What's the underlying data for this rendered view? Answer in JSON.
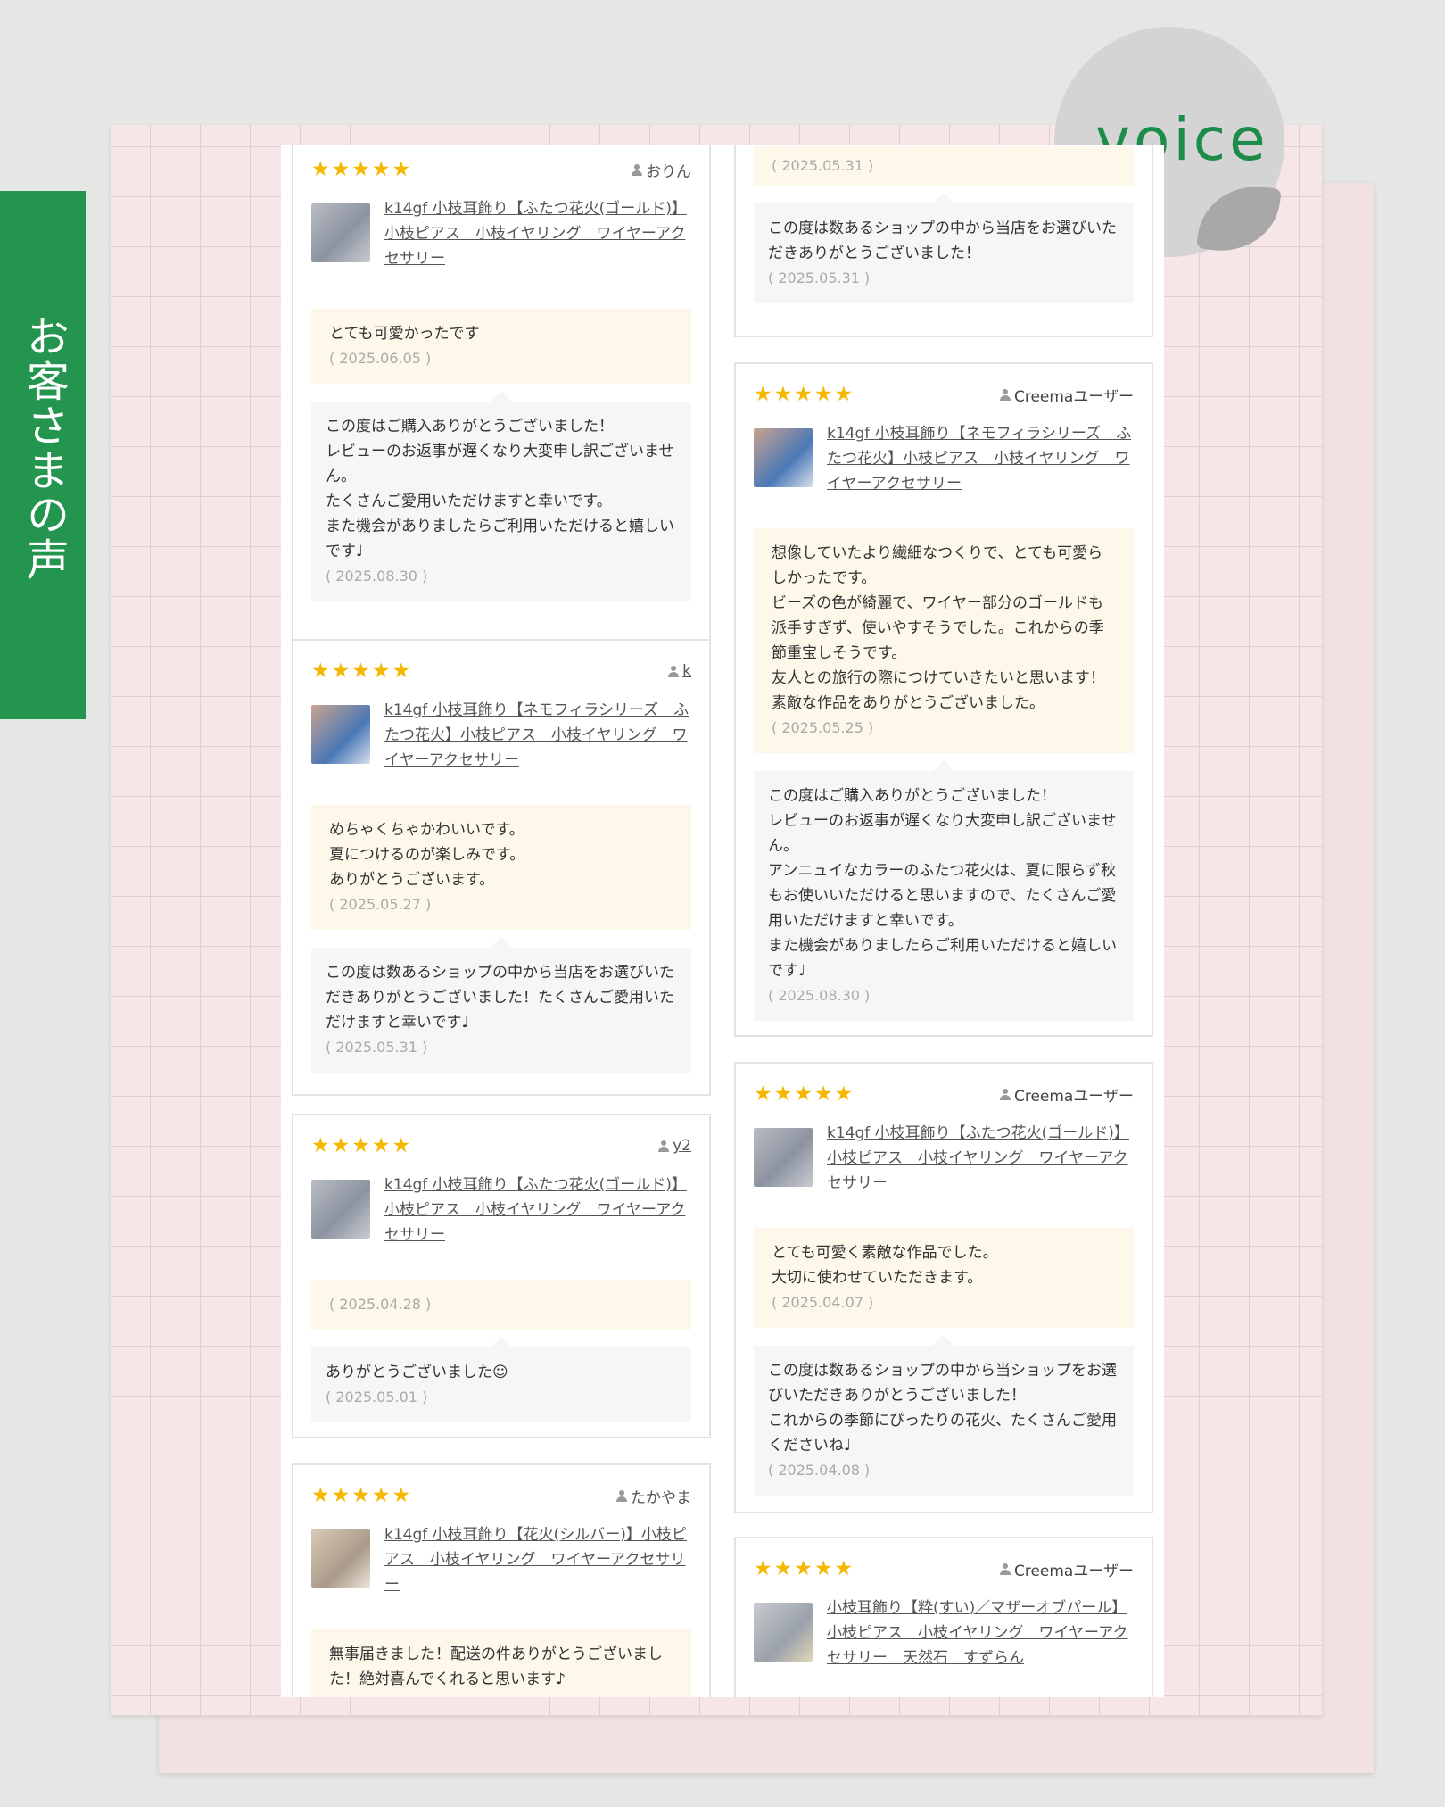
{
  "side_tab": "お客さまの声",
  "badge": "voice",
  "colors": {
    "accent_green": "#23954e",
    "star": "#f5b800",
    "review_bg": "#fdf8ea",
    "reply_bg": "#f6f6f6"
  },
  "left_column": [
    {
      "stars": "★★★★★",
      "user": "おりん",
      "product": "k14gf 小枝耳飾り【ふたつ花火(ゴールド)】小枝ピアス　小枝イヤリング　ワイヤーアクセサリー",
      "review_text": "とても可愛かったです",
      "review_date": "( 2025.06.05 )",
      "reply_text": "この度はご購入ありがとうございました！\nレビューのお返事が遅くなり大変申し訳ございません。\nたくさんご愛用いただけますと幸いです。\nまた機会がありましたらご利用いただけると嬉しいです♩",
      "reply_date": "( 2025.08.30 )"
    },
    {
      "stars": "★★★★★",
      "user": "k",
      "product": "k14gf 小枝耳飾り【ネモフィラシリーズ　ふたつ花火】小枝ピアス　小枝イヤリング　ワイヤーアクセサリー",
      "review_text": "めちゃくちゃかわいいです。\n夏につけるのが楽しみです。\nありがとうございます。",
      "review_date": "( 2025.05.27 )",
      "reply_text": "この度は数あるショップの中から当店をお選びいただきありがとうございました！たくさんご愛用いただけますと幸いです♩",
      "reply_date": "( 2025.05.31 )"
    },
    {
      "stars": "★★★★★",
      "user": "y2",
      "product": "k14gf 小枝耳飾り【ふたつ花火(ゴールド)】小枝ピアス　小枝イヤリング　ワイヤーアクセサリー",
      "review_text": "",
      "review_date": "( 2025.04.28 )",
      "reply_text": "ありがとうございました☺",
      "reply_date": "( 2025.05.01 )"
    },
    {
      "stars": "★★★★★",
      "user": "たかやま",
      "product": "k14gf 小枝耳飾り【花火(シルバー)】小枝ピアス　小枝イヤリング　ワイヤーアクセサリー",
      "review_text": "無事届きました！配送の件ありがとうございました！絶対喜んでくれると思います♪",
      "review_date": "",
      "reply_text": "",
      "reply_date": ""
    }
  ],
  "right_column": [
    {
      "review_date": "( 2025.05.31 )",
      "reply_text": "この度は数あるショップの中から当店をお選びいただきありがとうございました！",
      "reply_date": "( 2025.05.31 )"
    },
    {
      "stars": "★★★★★",
      "user": "Creemaユーザー",
      "product": "k14gf 小枝耳飾り【ネモフィラシリーズ　ふたつ花火】小枝ピアス　小枝イヤリング　ワイヤーアクセサリー",
      "review_text": "想像していたより繊細なつくりで、とても可愛らしかったです。\nビーズの色が綺麗で、ワイヤー部分のゴールドも派手すぎず、使いやすそうでした。これからの季節重宝しそうです。\n友人との旅行の際につけていきたいと思います！\n素敵な作品をありがとうございました。",
      "review_date": "( 2025.05.25 )",
      "reply_text": "この度はご購入ありがとうございました！\nレビューのお返事が遅くなり大変申し訳ございません。\nアンニュイなカラーのふたつ花火は、夏に限らず秋もお使いいただけると思いますので、たくさんご愛用いただけますと幸いです。\nまた機会がありましたらご利用いただけると嬉しいです♩",
      "reply_date": "( 2025.08.30 )"
    },
    {
      "stars": "★★★★★",
      "user": "Creemaユーザー",
      "product": "k14gf 小枝耳飾り【ふたつ花火(ゴールド)】小枝ピアス　小枝イヤリング　ワイヤーアクセサリー",
      "review_text": "とても可愛く素敵な作品でした。\n大切に使わせていただきます。",
      "review_date": "( 2025.04.07 )",
      "reply_text": "この度は数あるショップの中から当ショップをお選びいただきありがとうございました！\nこれからの季節にぴったりの花火、たくさんご愛用くださいね♩",
      "reply_date": "( 2025.04.08 )"
    },
    {
      "stars": "★★★★★",
      "user": "Creemaユーザー",
      "product": "小枝耳飾り【粋(すい)／マザーオブパール】小枝ピアス　小枝イヤリング　ワイヤーアクセサリー　天然石　すずらん"
    }
  ]
}
